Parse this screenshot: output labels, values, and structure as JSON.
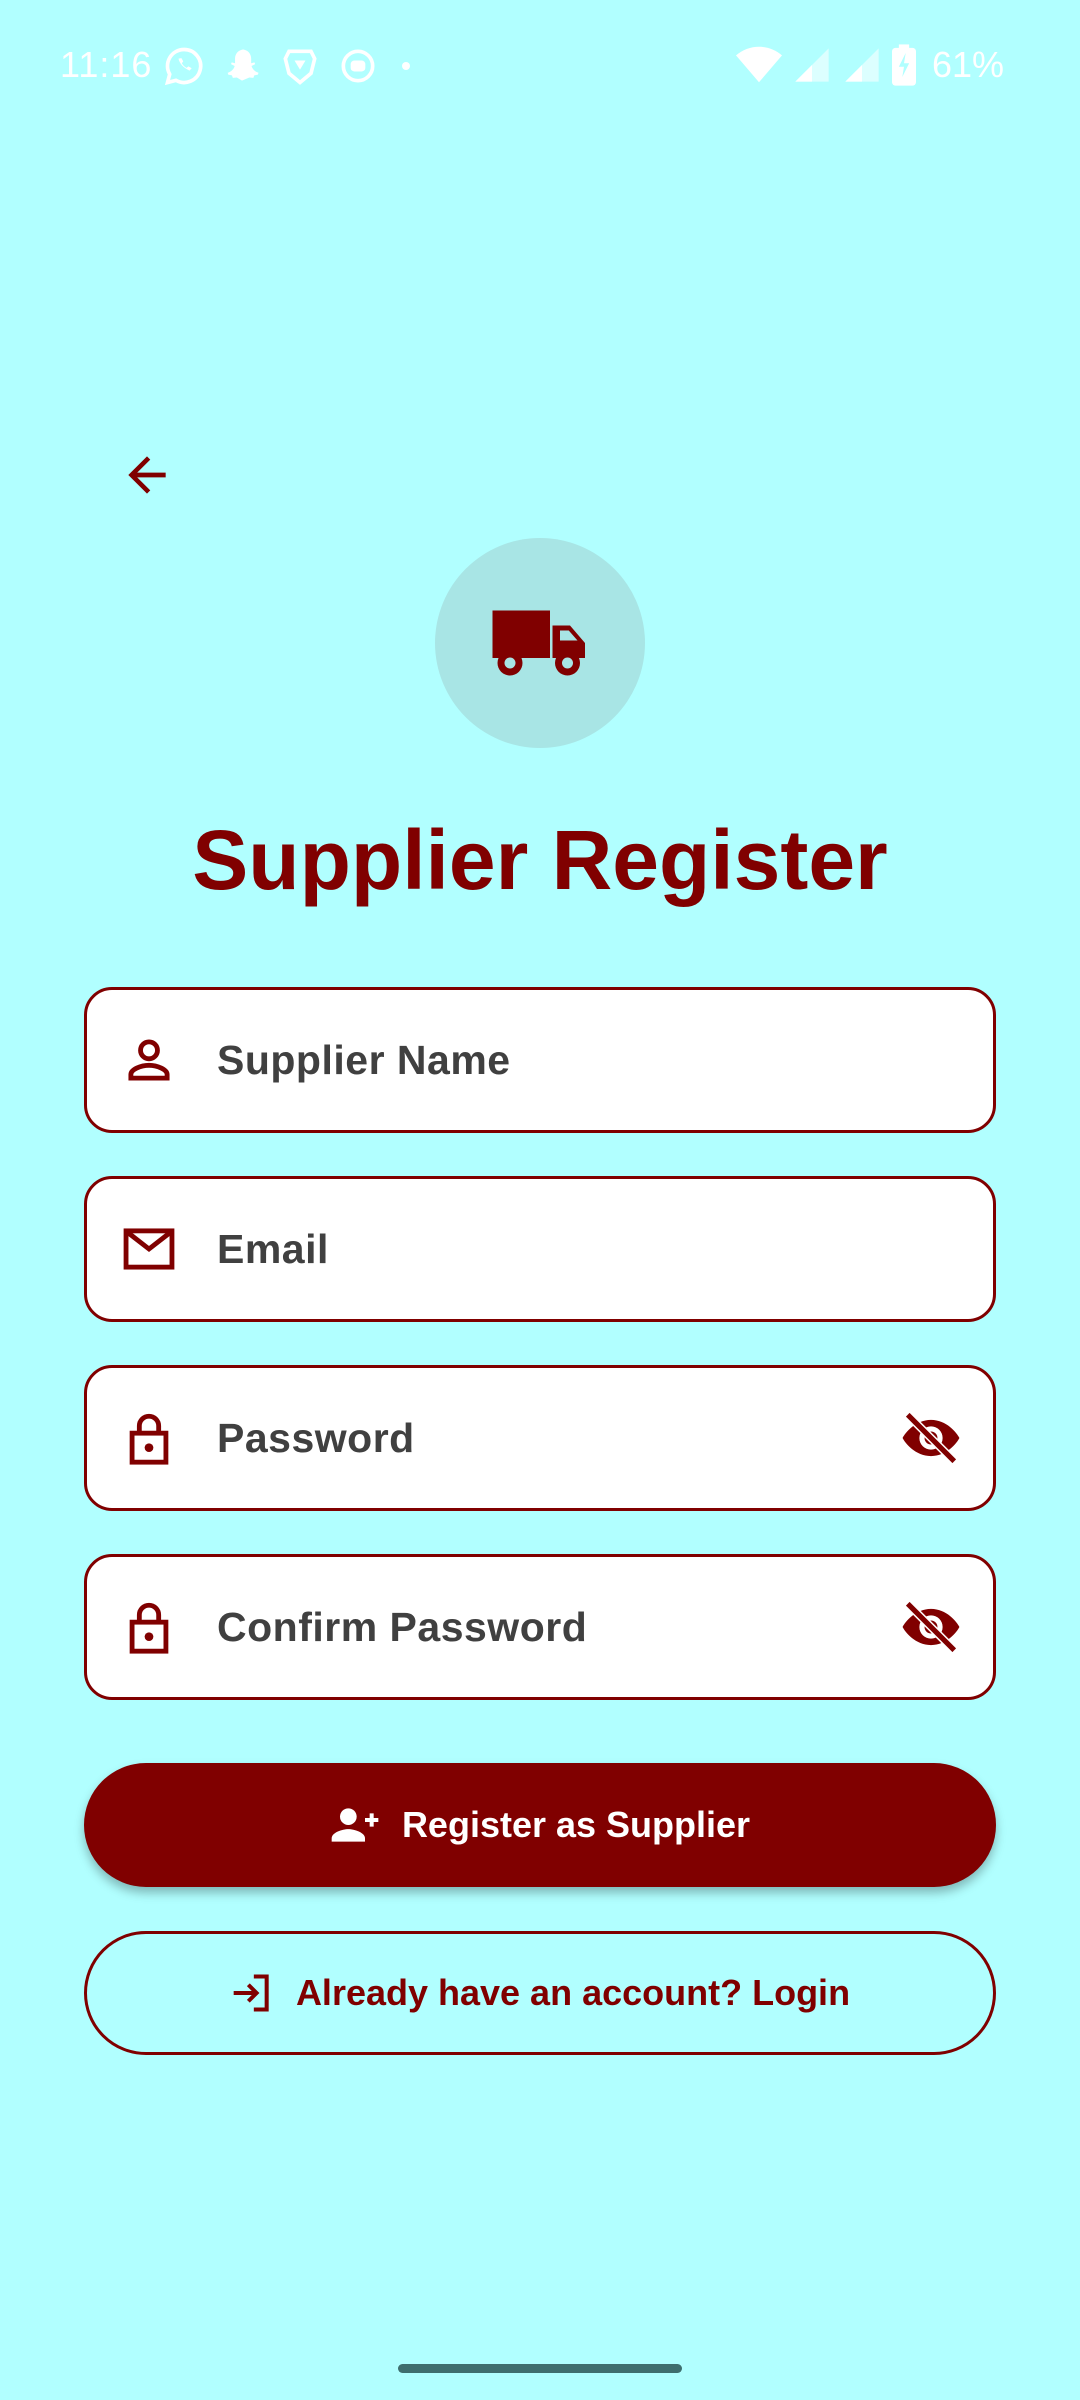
{
  "status_bar": {
    "time": "11:16",
    "battery": "61%",
    "left_icons": [
      "whatsapp-icon",
      "snapchat-icon",
      "brave-icon",
      "app-icon",
      "dot-icon"
    ],
    "right_icons": [
      "wifi-icon",
      "signal-icon",
      "signal-icon",
      "battery-charging-icon"
    ]
  },
  "header": {
    "back_icon": "arrow-back-icon",
    "logo_icon": "truck-icon",
    "title": "Supplier Register"
  },
  "form": {
    "name": {
      "placeholder": "Supplier Name",
      "icon": "person-icon"
    },
    "email": {
      "placeholder": "Email",
      "icon": "mail-icon"
    },
    "password": {
      "placeholder": "Password",
      "icon": "lock-icon",
      "toggle_icon": "eye-off-icon"
    },
    "confirm_password": {
      "placeholder": "Confirm Password",
      "icon": "lock-icon",
      "toggle_icon": "eye-off-icon"
    }
  },
  "actions": {
    "register_label": "Register as Supplier",
    "register_icon": "person-add-icon",
    "login_label": "Already have an account? Login",
    "login_icon": "login-icon"
  },
  "colors": {
    "background": "#b1ffff",
    "primary": "#800000",
    "logo_circle": "#a8e5e5",
    "field_text": "#404040"
  }
}
